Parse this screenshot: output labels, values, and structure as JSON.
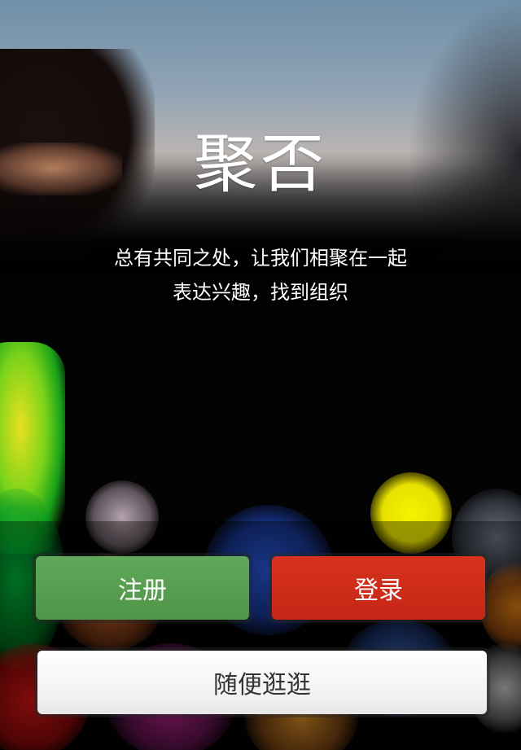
{
  "app": {
    "title": "聚否",
    "tagline_lines": [
      "总有共同之处，让我们相聚在一起",
      "表达兴趣，找到组织"
    ]
  },
  "actions": {
    "register_label": "注册",
    "login_label": "登录",
    "browse_label": "随便逛逛"
  },
  "colors": {
    "register": "#5a9f52",
    "login": "#d02c1b",
    "browse": "#f4f4f4"
  }
}
